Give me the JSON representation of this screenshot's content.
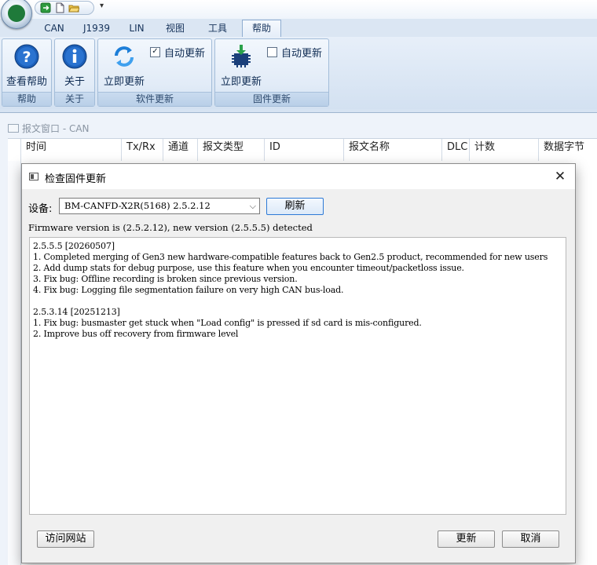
{
  "ribbon": {
    "tabs": [
      {
        "label": "CAN"
      },
      {
        "label": "J1939"
      },
      {
        "label": "LIN"
      },
      {
        "label": "视图"
      },
      {
        "label": "工具"
      },
      {
        "label": "帮助"
      }
    ],
    "active_tab": "帮助",
    "help_group": {
      "label": "帮助",
      "button": "查看帮助",
      "icon": "help-icon"
    },
    "about_group": {
      "label": "关于",
      "button": "关于",
      "icon": "info-icon"
    },
    "software_group": {
      "label": "软件更新",
      "button": "立即更新",
      "auto_label": "自动更新",
      "auto_checked": true,
      "icon": "refresh-icon"
    },
    "firmware_group": {
      "label": "固件更新",
      "button": "立即更新",
      "auto_label": "自动更新",
      "auto_checked": false,
      "icon": "chip-download-icon"
    }
  },
  "message_window": {
    "title": "报文窗口 - CAN",
    "columns": [
      "时间",
      "Tx/Rx",
      "通道",
      "报文类型",
      "ID",
      "报文名称",
      "DLC",
      "计数",
      "数据字节"
    ]
  },
  "dialog": {
    "title": "检查固件更新",
    "device_label": "设备:",
    "device_value": "BM-CANFD-X2R(5168) 2.5.2.12",
    "refresh_label": "刷新",
    "status": "Firmware version is (2.5.2.12), new version (2.5.5.5) detected",
    "release_notes": [
      "2.5.5.5 [20260507]",
      "1. Completed merging of Gen3 new hardware-compatible features back to Gen2.5 product, recommended for new users",
      "2. Add dump stats for debug purpose, use this feature when you encounter timeout/packetloss issue.",
      "3. Fix bug: Offline recording is broken since previous version.",
      "4. Fix bug: Logging file segmentation failure on very high CAN bus-load.",
      "",
      "2.5.3.14 [20251213]",
      "1. Fix bug: busmaster get stuck when \"Load config\" is pressed if sd card is mis-configured.",
      "2. Improve bus off recovery from firmware level"
    ],
    "visit_site_label": "访问网站",
    "update_label": "更新",
    "cancel_label": "取消"
  }
}
